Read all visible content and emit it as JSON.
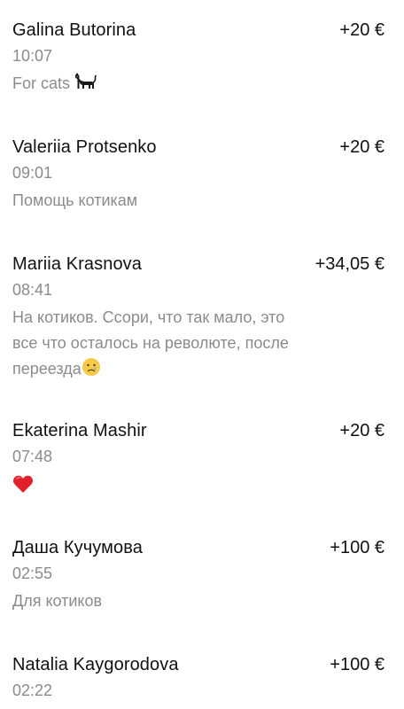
{
  "transactions": [
    {
      "name": "Galina Butorina",
      "amount": "+20 €",
      "time": "10:07",
      "note": "For cats",
      "emoji": "black-cat-icon"
    },
    {
      "name": "Valeriia Protsenko",
      "amount": "+20 €",
      "time": "09:01",
      "note": "Помощь котикам"
    },
    {
      "name": "Mariia Krasnova",
      "amount": "+34,05 €",
      "time": "08:41",
      "note": "На котиков. Ссори, что так мало, это все что осталось на революте, после переезда",
      "emoji": "crying-face-icon"
    },
    {
      "name": "Ekaterina Mashir",
      "amount": "+20 €",
      "time": "07:48",
      "note": "",
      "emoji": "red-heart-icon"
    },
    {
      "name": "Даша Кучумова",
      "amount": "+100 €",
      "time": "02:55",
      "note": "Для котиков"
    },
    {
      "name": "Natalia Kaygorodova",
      "amount": "+100 €",
      "time": "02:22"
    }
  ]
}
